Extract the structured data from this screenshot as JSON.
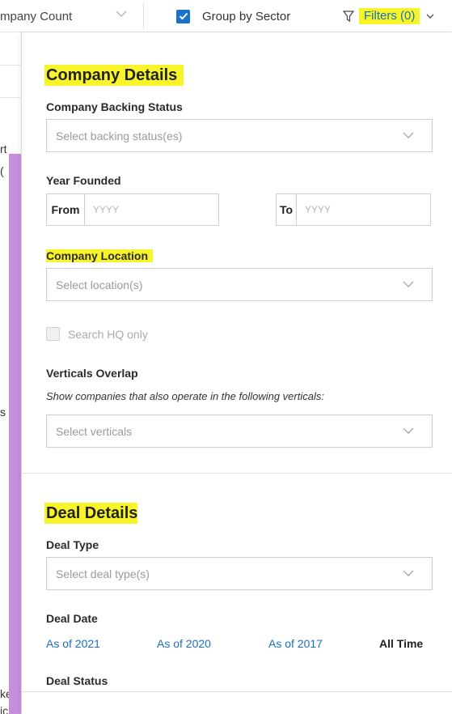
{
  "topbar": {
    "count_select": {
      "value_fragment": "mpany Count"
    },
    "group_by_sector": {
      "label": "Group by Sector",
      "checked": true
    },
    "filters_button": {
      "label": "Filters (0)",
      "icon": "filter-icon"
    },
    "accent_color": "#1a73c8",
    "highlight_color": "#f7f52a"
  },
  "background": {
    "purple_bar_color": "#c68fdb",
    "fragments": [
      "rt",
      "(",
      "s",
      "ke",
      "ic"
    ]
  },
  "company_details": {
    "title": "Company Details",
    "backing_status": {
      "label": "Company Backing Status",
      "placeholder": "Select backing status(es)"
    },
    "year_founded": {
      "label": "Year Founded",
      "from_label": "From",
      "from_placeholder": "YYYY",
      "to_label": "To",
      "to_placeholder": "YYYY"
    },
    "location": {
      "label": "Company Location",
      "placeholder": "Select location(s)"
    },
    "search_hq": {
      "label": "Search HQ only",
      "checked": false
    },
    "verticals_overlap": {
      "label": "Verticals Overlap",
      "note": "Show companies that also operate in the following verticals:",
      "placeholder": "Select verticals"
    }
  },
  "deal_details": {
    "title": "Deal Details",
    "deal_type": {
      "label": "Deal Type",
      "placeholder": "Select deal type(s)"
    },
    "deal_date": {
      "label": "Deal Date",
      "options": [
        "As of 2021",
        "As of 2020",
        "As of 2017",
        "All Time"
      ],
      "selected": "All Time"
    },
    "deal_status": {
      "label": "Deal Status"
    }
  }
}
